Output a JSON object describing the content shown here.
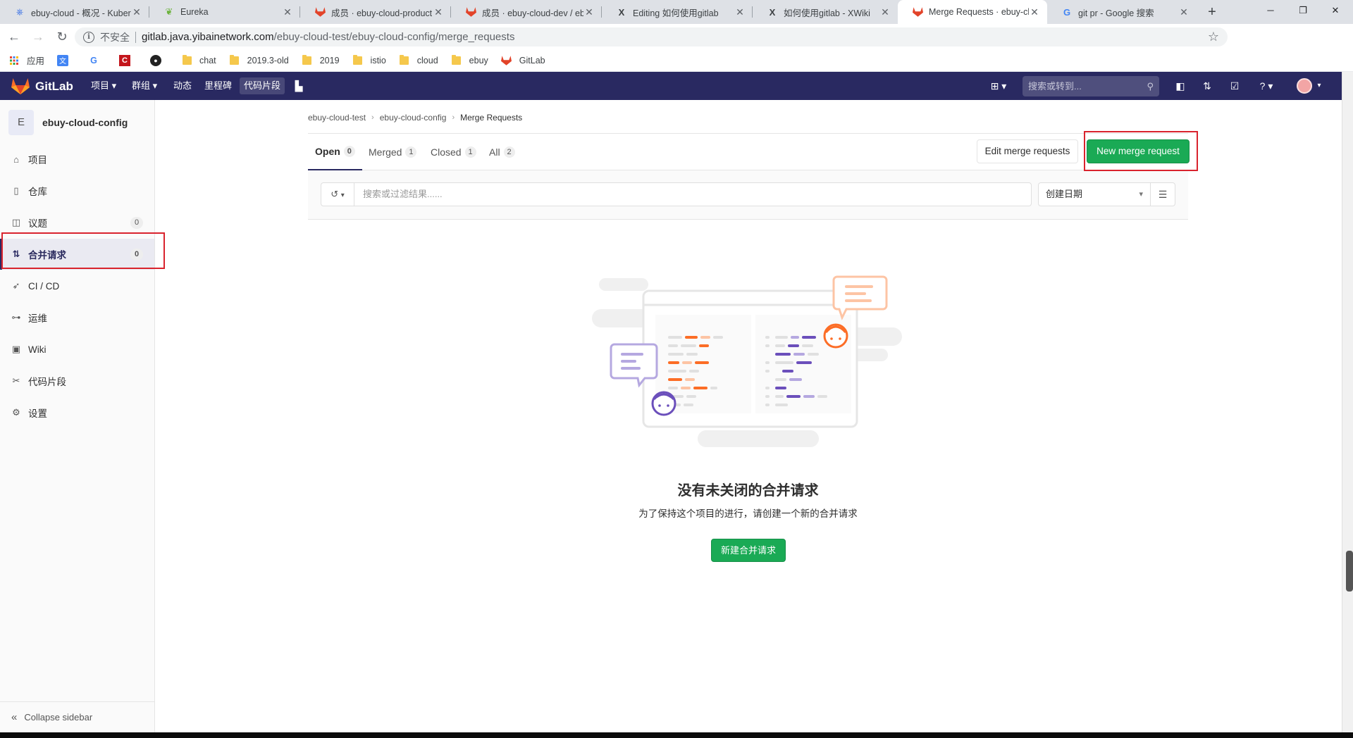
{
  "browser": {
    "tabs": [
      {
        "title": "ebuy-cloud - 概况 - Kubernetes",
        "icon": "kubernetes-icon",
        "active": false
      },
      {
        "title": "Eureka",
        "icon": "spring-leaf-icon",
        "active": false
      },
      {
        "title": "成员 · ebuy-cloud-product",
        "icon": "gitlab-icon",
        "active": false
      },
      {
        "title": "成员 · ebuy-cloud-dev / ebuy",
        "icon": "gitlab-icon",
        "active": false
      },
      {
        "title": "Editing 如何使用gitlab",
        "icon": "xwiki-icon",
        "active": false
      },
      {
        "title": "如何使用gitlab - XWiki",
        "icon": "xwiki-icon",
        "active": false
      },
      {
        "title": "Merge Requests · ebuy-cloud",
        "icon": "gitlab-icon",
        "active": true
      },
      {
        "title": "git pr - Google 搜索",
        "icon": "google-icon",
        "active": false
      }
    ],
    "address": {
      "security_label": "不安全",
      "host": "gitlab.java.yibainetwork.com",
      "path": "/ebuy-cloud-test/ebuy-cloud-config/merge_requests"
    },
    "bookmarks": [
      {
        "label": "应用",
        "icon": "apps-grid-icon"
      },
      {
        "label": "",
        "icon": "google-translate-icon"
      },
      {
        "label": "",
        "icon": "google-icon"
      },
      {
        "label": "",
        "icon": "red-c-icon"
      },
      {
        "label": "",
        "icon": "github-icon"
      },
      {
        "label": "chat",
        "icon": "folder-icon"
      },
      {
        "label": "2019.3-old",
        "icon": "folder-icon"
      },
      {
        "label": "2019",
        "icon": "folder-icon"
      },
      {
        "label": "istio",
        "icon": "folder-icon"
      },
      {
        "label": "cloud",
        "icon": "folder-icon"
      },
      {
        "label": "ebuy",
        "icon": "folder-icon"
      },
      {
        "label": "GitLab",
        "icon": "gitlab-icon"
      }
    ]
  },
  "gitlab": {
    "brand": "GitLab",
    "menu": [
      {
        "label": "项目 ▾"
      },
      {
        "label": "群组 ▾"
      },
      {
        "label": "动态"
      },
      {
        "label": "里程碑"
      },
      {
        "label": "代码片段"
      }
    ],
    "search_placeholder": "搜索或转到..."
  },
  "sidebar": {
    "project_initial": "E",
    "project_name": "ebuy-cloud-config",
    "items": [
      {
        "label": "项目",
        "icon": "home-icon",
        "count": ""
      },
      {
        "label": "仓库",
        "icon": "doc-icon",
        "count": ""
      },
      {
        "label": "议题",
        "icon": "issues-icon",
        "count": "0"
      },
      {
        "label": "合并请求",
        "icon": "merge-request-icon",
        "count": "0"
      },
      {
        "label": "CI / CD",
        "icon": "rocket-icon",
        "count": ""
      },
      {
        "label": "运维",
        "icon": "operations-icon",
        "count": ""
      },
      {
        "label": "Wiki",
        "icon": "book-icon",
        "count": ""
      },
      {
        "label": "代码片段",
        "icon": "scissors-icon",
        "count": ""
      },
      {
        "label": "设置",
        "icon": "gear-icon",
        "count": ""
      }
    ],
    "collapse_label": "Collapse sidebar"
  },
  "main": {
    "breadcrumb": [
      "ebuy-cloud-test",
      "ebuy-cloud-config",
      "Merge Requests"
    ],
    "tabs": [
      {
        "label": "Open",
        "count": "0"
      },
      {
        "label": "Merged",
        "count": "1"
      },
      {
        "label": "Closed",
        "count": "1"
      },
      {
        "label": "All",
        "count": "2"
      }
    ],
    "edit_button": "Edit merge requests",
    "new_button": "New merge request",
    "filter_placeholder": "搜索或过滤结果......",
    "sort_label": "创建日期",
    "empty_title": "没有未关闭的合并请求",
    "empty_subtitle": "为了保持这个项目的进行，请创建一个新的合并请求",
    "empty_button": "新建合并请求"
  },
  "colors": {
    "navbar": "#292961",
    "success": "#1aaa55",
    "annotation": "#d9232d"
  }
}
